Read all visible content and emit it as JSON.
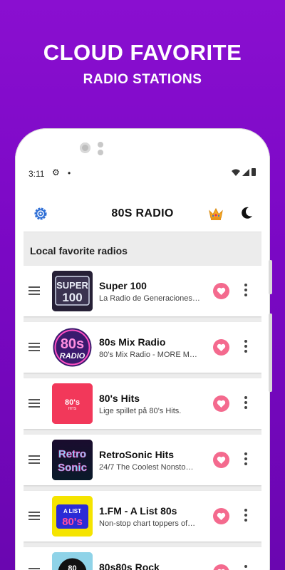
{
  "promo": {
    "headline": "CLOUD FAVORITE",
    "subheadline": "RADIO STATIONS"
  },
  "statusbar": {
    "time": "3:11",
    "gear": "⚙",
    "dot": "•"
  },
  "appbar": {
    "title": "80S RADIO"
  },
  "section": {
    "title": "Local favorite radios"
  },
  "stations": [
    {
      "name": "Super 100",
      "description": "La Radio de Generaciones…",
      "logo_text": "SUPER 100"
    },
    {
      "name": "80s Mix Radio",
      "description": "80’s Mix Radio - MORE M…",
      "logo_text": "80s RADIO"
    },
    {
      "name": "80's Hits",
      "description": "Lige spillet på 80’s Hits.",
      "logo_text": "80's HITS"
    },
    {
      "name": "RetroSonic Hits",
      "description": "24/7 The Coolest Nonsto…",
      "logo_text": "Retro Sonic"
    },
    {
      "name": "1.FM - A List 80s",
      "description": "Non-stop chart toppers of…",
      "logo_text": "A LIST 80's"
    },
    {
      "name": "80s80s Rock",
      "description": "",
      "logo_text": "80"
    }
  ],
  "colors": {
    "background": "#7a08c4",
    "heart": "#f46a8e",
    "settings_accent": "#2f6fd6"
  }
}
